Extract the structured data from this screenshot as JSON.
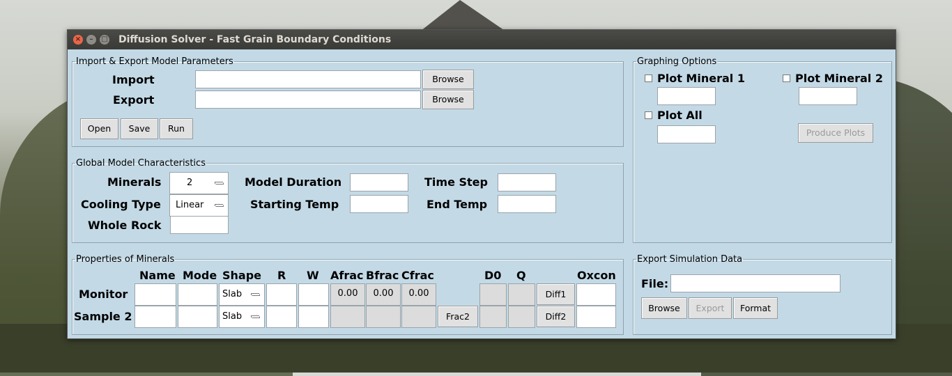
{
  "window": {
    "title": "Diffusion Solver - Fast Grain Boundary Conditions"
  },
  "import_export": {
    "legend": "Import & Export Model Parameters",
    "import_label": "Import",
    "export_label": "Export",
    "browse_label": "Browse",
    "open_label": "Open",
    "save_label": "Save",
    "run_label": "Run"
  },
  "global": {
    "legend": "Global Model Characteristics",
    "minerals_label": "Minerals",
    "minerals_value": "2",
    "cooling_label": "Cooling Type",
    "cooling_value": "Linear",
    "whole_rock_label": "Whole Rock",
    "duration_label": "Model Duration",
    "start_temp_label": "Starting Temp",
    "time_step_label": "Time Step",
    "end_temp_label": "End Temp"
  },
  "properties": {
    "legend": "Properties of Minerals",
    "headers": [
      "Name",
      "Mode",
      "Shape",
      "R",
      "W",
      "Afrac",
      "Bfrac",
      "Cfrac",
      "D0",
      "Q",
      "Oxcon"
    ],
    "rows": [
      {
        "label": "Monitor",
        "shape": "Slab",
        "afrac": "0.00",
        "bfrac": "0.00",
        "cfrac": "0.00",
        "diff": "Diff1"
      },
      {
        "label": "Sample 2",
        "shape": "Slab",
        "frac": "Frac2",
        "diff": "Diff2"
      }
    ]
  },
  "graphing": {
    "legend": "Graphing Options",
    "plot1": "Plot Mineral 1",
    "plot2": "Plot Mineral 2",
    "plot_all": "Plot All",
    "produce": "Produce Plots"
  },
  "export_sim": {
    "legend": "Export Simulation Data",
    "file_label": "File:",
    "browse": "Browse",
    "export": "Export",
    "format": "Format"
  }
}
